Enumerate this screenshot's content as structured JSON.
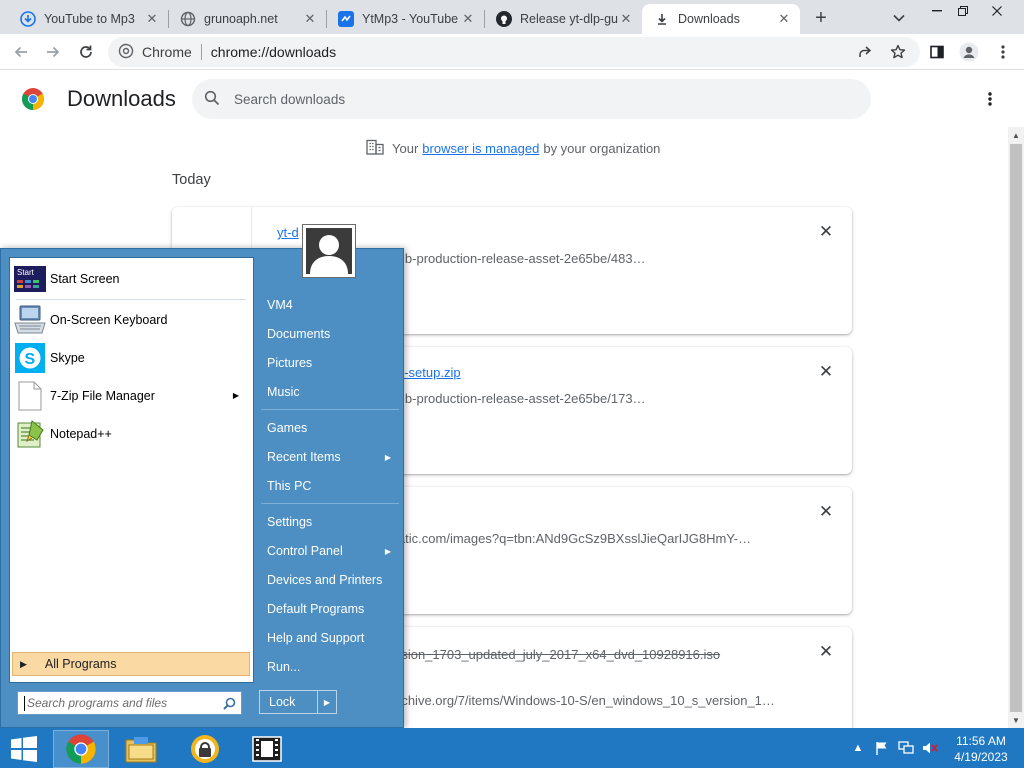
{
  "browser": {
    "tabs": [
      {
        "title": "YouTube to Mp3",
        "favicon": "download-circle-icon"
      },
      {
        "title": "grunoaph.net",
        "favicon": "globe-icon"
      },
      {
        "title": "YtMp3 - YouTube",
        "favicon": "ytmp3-icon"
      },
      {
        "title": "Release yt-dlp-gu",
        "favicon": "github-icon"
      },
      {
        "title": "Downloads",
        "favicon": "download-icon",
        "active": true
      }
    ],
    "new_tab_label": "+",
    "omnibox": {
      "site": "Chrome",
      "url": "chrome://downloads"
    },
    "accent": "#1a73e8"
  },
  "downloads": {
    "title": "Downloads",
    "search_placeholder": "Search downloads",
    "managed_prefix": "Your",
    "managed_link": "browser is managed",
    "managed_suffix": "by your organization",
    "section": "Today",
    "items": [
      {
        "name": "yt-d",
        "url": "usercontent.com/github-production-release-asset-2e65be/483…",
        "strike": false
      },
      {
        "name": "n-setup.zip",
        "url": "usercontent.com/github-production-release-asset-2e65be/173…",
        "strike": false
      },
      {
        "name": "",
        "url": ".gstatic.com/images?q=tbn:ANd9GcSz9BXsslJieQarIJG8HmY-…",
        "strike": false
      },
      {
        "name": "rsion_1703_updated_july_2017_x64_dvd_10928916.iso",
        "url": "rchive.org/7/items/Windows-10-S/en_windows_10_s_version_1…",
        "strike": true
      }
    ]
  },
  "start_menu": {
    "pinned": [
      {
        "label": "Start Screen",
        "icon": "start-screen-icon",
        "badge": "Start"
      },
      {
        "label": "On-Screen Keyboard",
        "icon": "keyboard-icon"
      },
      {
        "label": "Skype",
        "icon": "skype-icon"
      },
      {
        "label": "7-Zip File Manager",
        "icon": "file-icon",
        "submenu": true
      },
      {
        "label": "Notepad++",
        "icon": "notepad-icon"
      }
    ],
    "all_programs": "All Programs",
    "search_placeholder": "Search programs and files",
    "right": [
      {
        "label": "VM4"
      },
      {
        "label": "Documents"
      },
      {
        "label": "Pictures"
      },
      {
        "label": "Music"
      },
      {
        "label": "Games"
      },
      {
        "label": "Recent Items",
        "submenu": true
      },
      {
        "label": "This PC"
      },
      {
        "label": "Settings"
      },
      {
        "label": "Control Panel",
        "submenu": true
      },
      {
        "label": "Devices and Printers"
      },
      {
        "label": "Default Programs"
      },
      {
        "label": "Help and Support"
      },
      {
        "label": "Run..."
      }
    ],
    "lock_label": "Lock"
  },
  "taskbar": {
    "apps": [
      "chrome-icon",
      "file-explorer-icon",
      "vpn-icon",
      "video-player-icon"
    ],
    "clock": {
      "time": "11:56 AM",
      "date": "4/19/2023"
    }
  }
}
